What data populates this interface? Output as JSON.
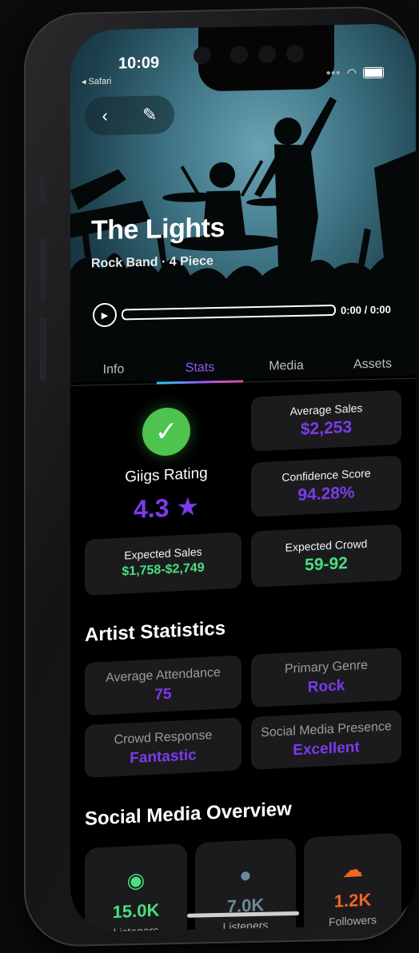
{
  "status_bar": {
    "time": "10:09",
    "back_app": "◂ Safari"
  },
  "nav": {
    "back_icon": "‹",
    "edit_icon": "✎"
  },
  "band": {
    "name": "The Lights",
    "subtitle": "Rock Band · 4 Piece"
  },
  "player": {
    "play_icon": "▶",
    "time": "0:00 / 0:00"
  },
  "tabs": [
    {
      "label": "Info"
    },
    {
      "label": "Stats"
    },
    {
      "label": "Media"
    },
    {
      "label": "Assets"
    }
  ],
  "rating": {
    "check_icon": "✓",
    "label": "Giigs Rating",
    "value": "4.3 ★"
  },
  "cards": {
    "average_sales": {
      "label": "Average Sales",
      "value": "$2,253"
    },
    "confidence": {
      "label": "Confidence Score",
      "value": "94.28%"
    },
    "expected_sales": {
      "label": "Expected Sales",
      "value": "$1,758-$2,749"
    },
    "expected_crowd": {
      "label": "Expected Crowd",
      "value": "59-92"
    }
  },
  "artist_stats": {
    "title": "Artist Statistics",
    "items": [
      {
        "label": "Average Attendance",
        "value": "75"
      },
      {
        "label": "Primary Genre",
        "value": "Rock"
      },
      {
        "label": "Crowd Response",
        "value": "Fantastic"
      },
      {
        "label": "Social Media Presence",
        "value": "Excellent"
      }
    ]
  },
  "social": {
    "title": "Social Media Overview",
    "items": [
      {
        "icon": "spotify-icon",
        "value": "15.0K",
        "caption": "Listeners",
        "color": "#4ade80"
      },
      {
        "icon": "apple-icon",
        "value": "7.0K",
        "caption": "Listeners",
        "color": "#6b8a99"
      },
      {
        "icon": "soundcloud-icon",
        "value": "1.2K",
        "caption": "Followers",
        "color": "#f26522"
      }
    ]
  }
}
